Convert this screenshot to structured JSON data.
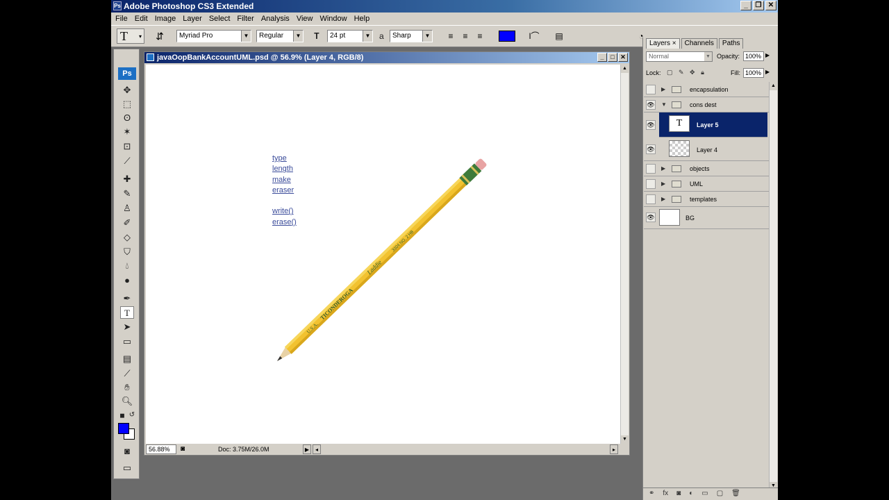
{
  "window": {
    "title": "Adobe Photoshop CS3 Extended",
    "minimize": "_",
    "restore": "❐",
    "close": "✕"
  },
  "menu": [
    "File",
    "Edit",
    "Image",
    "Layer",
    "Select",
    "Filter",
    "Analysis",
    "View",
    "Window",
    "Help"
  ],
  "options": {
    "tool_glyph": "T",
    "font_family": "Myriad Pro",
    "font_style": "Regular",
    "font_size": "24 pt",
    "antialias_prefix": "a",
    "antialias": "Sharp",
    "text_color": "#0000ff"
  },
  "document": {
    "title": "javaOopBankAccountUML.psd @ 56.9% (Layer 4, RGB/8)",
    "zoom": "56.88%",
    "doc_info": "Doc: 3.75M/26.0M",
    "uml_lines": [
      "type",
      "length",
      "make",
      "eraser",
      "",
      "write()",
      "erase()"
    ]
  },
  "toolbox": {
    "logo": "Ps",
    "foreground_color": "#0000ff",
    "background_color": "#ffffff"
  },
  "layers_panel": {
    "tabs": [
      "Layers ×",
      "Channels",
      "Paths"
    ],
    "blend_mode": "Normal",
    "opacity_label": "Opacity:",
    "opacity_value": "100%",
    "lock_label": "Lock:",
    "fill_label": "Fill:",
    "fill_value": "100%",
    "layers": [
      {
        "name": "encapsulation",
        "type": "group",
        "visible": false,
        "expanded": false
      },
      {
        "name": "cons dest",
        "type": "group",
        "visible": true,
        "expanded": true
      },
      {
        "name": "Layer 5",
        "type": "text",
        "visible": true,
        "selected": true
      },
      {
        "name": "Layer 4",
        "type": "raster",
        "visible": true
      },
      {
        "name": "objects",
        "type": "group",
        "visible": false,
        "expanded": false
      },
      {
        "name": "UML",
        "type": "group",
        "visible": false,
        "expanded": false
      },
      {
        "name": "templates",
        "type": "group",
        "visible": false,
        "expanded": false
      },
      {
        "name": "BG",
        "type": "raster",
        "visible": true
      }
    ]
  }
}
